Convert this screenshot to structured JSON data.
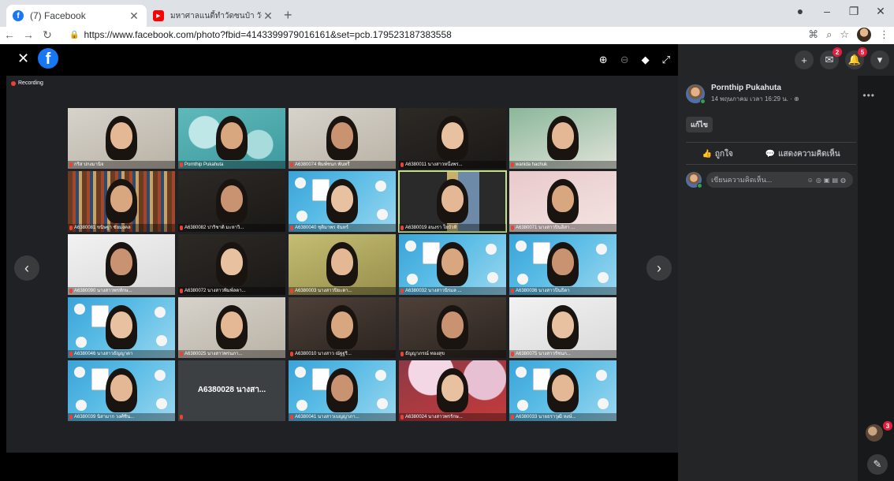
{
  "browser": {
    "tabs": [
      {
        "title": "(7) Facebook",
        "active": true,
        "favicon": "facebook-favicon"
      },
      {
        "title": "มหาศาลแนตี้ทำวัดซนป๋า วัดหนองป่าพง ...",
        "active": false,
        "favicon": "youtube-favicon"
      }
    ],
    "url": "https://www.facebook.com/photo?fbid=4143399979016161&set=pcb.179523187383558"
  },
  "viewer": {
    "recording_label": "Recording",
    "tiles": [
      {
        "name": "กริส ปกงมานิจ",
        "style": "room-light"
      },
      {
        "name": "Pornthip Pukahuta",
        "style": "teal-bubbles"
      },
      {
        "name": "A6380074 พิมพ์ชนก พันทรี",
        "style": "room-light"
      },
      {
        "name": "A6380011 นางสาวหนึ่งพร...",
        "style": "dark-room"
      },
      {
        "name": "wanida hachuk",
        "style": "room-green"
      },
      {
        "name": "A6380081 ขนิษฐา ชัยมงคล",
        "style": "bookshelf"
      },
      {
        "name": "A6380082 ปาริชาติ มะหาวิ...",
        "style": "dark-room"
      },
      {
        "name": "A6380040 ชุติมาพร จันทร์",
        "style": "medical"
      },
      {
        "name": "A6380019 อนงรา ใยบัวทิ",
        "style": "room-door",
        "highlight": true
      },
      {
        "name": "A6380071 นางสาวปินอิสา ...",
        "style": "room-pink"
      },
      {
        "name": "A6380090 นางสาวพรทักษ...",
        "style": "white-wall"
      },
      {
        "name": "A6380072 นางสาวพิมพ์ลดา...",
        "style": "dark-room"
      },
      {
        "name": "A6380003 นางสาวปิยะดา...",
        "style": "room-yellow"
      },
      {
        "name": "A6380032 นางสาวนิรมล ...",
        "style": "medical"
      },
      {
        "name": "A6380036 นางสาวปีนธิดา",
        "style": "medical"
      },
      {
        "name": "A6380046 นางสาวธัญญาดา",
        "style": "medical"
      },
      {
        "name": "A6380025 นางสาวพรนภา...",
        "style": "room-light"
      },
      {
        "name": "A6380010 นางสาว ณัฐฐริ...",
        "style": "room-dark-warm"
      },
      {
        "name": "ธัญญาภรณ์ ทองสุข",
        "style": "room-dark-warm"
      },
      {
        "name": "A6380075 นางสาวรัชนก...",
        "style": "white-wall"
      },
      {
        "name": "A6380039 นิสามาก วงศ์ชิน...",
        "style": "medical"
      },
      {
        "name": "A6380028 นางสา...",
        "style": "text-only"
      },
      {
        "name": "A6380041 นางสาวเบญญาภา...",
        "style": "medical"
      },
      {
        "name": "A6380024 นางสาวพรรักษ...",
        "style": "blossom"
      },
      {
        "name": "A6380033 นายธราวุฒิ หงษ์...",
        "style": "medical"
      }
    ]
  },
  "panel": {
    "author": "Pornthip Pukahuta",
    "date": "14 พฤษภาคม เวลา 16:29 น. · ⊕",
    "edit_label": "แก้ไข",
    "like_label": "ถูกใจ",
    "comment_label": "แสดงความคิดเห็น",
    "comment_placeholder": "เขียนความคิดเห็น...",
    "messenger_badge": "2",
    "notifications_badge": "5",
    "contacts_badge": "3"
  }
}
